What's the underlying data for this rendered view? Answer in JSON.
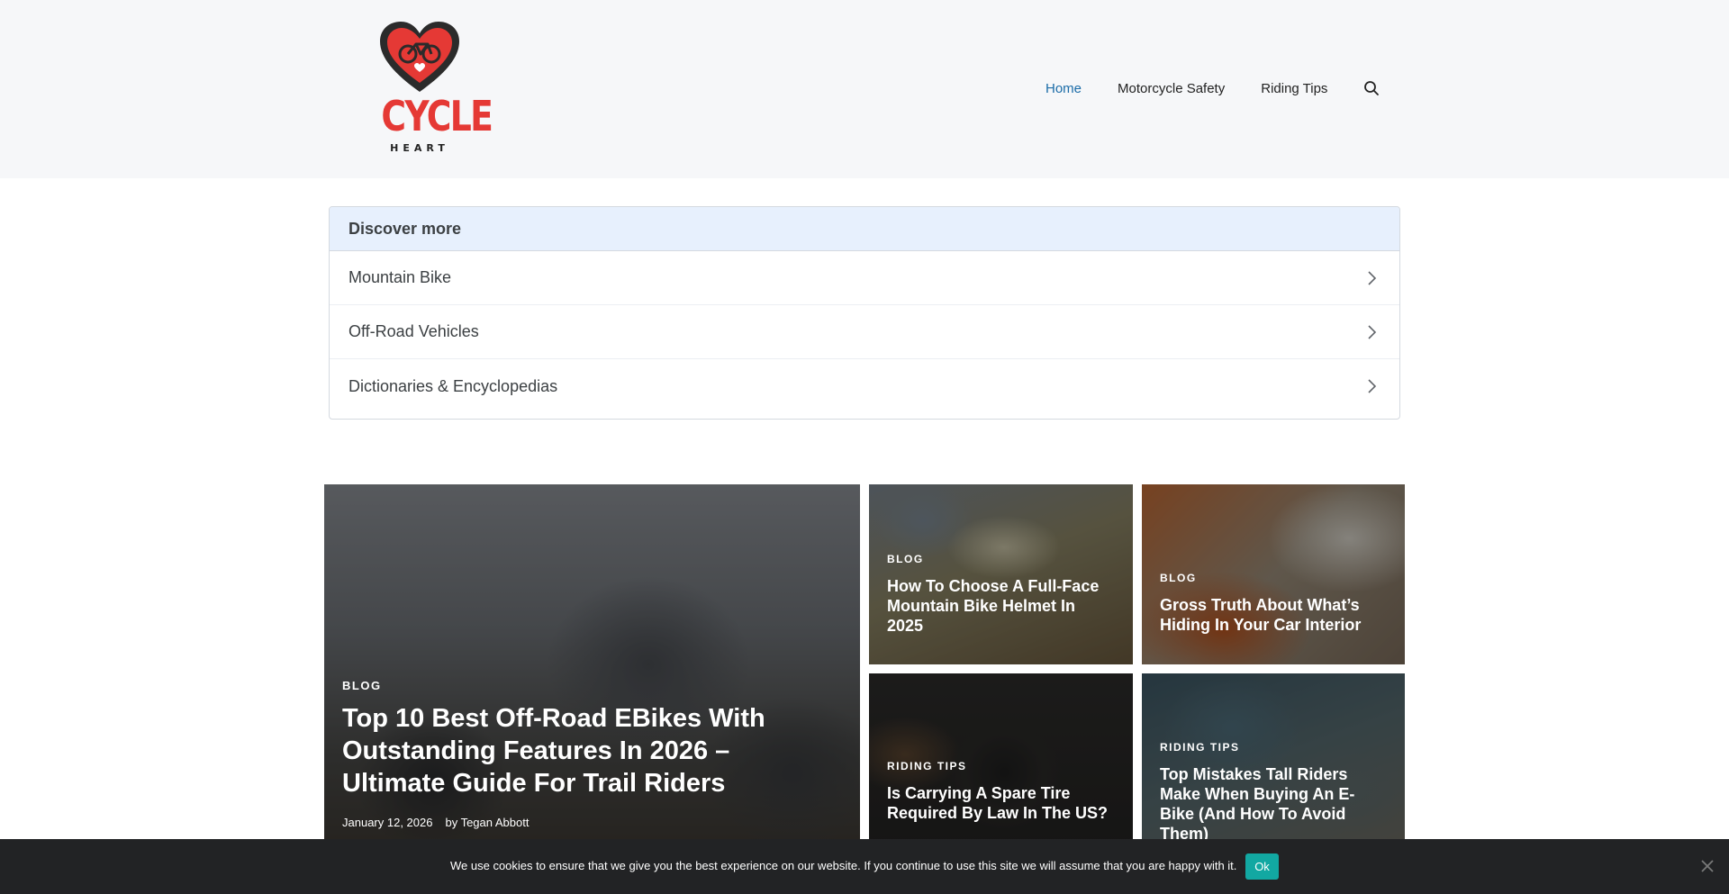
{
  "logo": {
    "word": "CYCLE",
    "sub": "HEART"
  },
  "nav": {
    "items": [
      {
        "label": "Home",
        "active": true
      },
      {
        "label": "Motorcycle Safety",
        "active": false
      },
      {
        "label": "Riding Tips",
        "active": false
      }
    ],
    "search_icon": "search-icon"
  },
  "discover": {
    "title": "Discover more",
    "items": [
      {
        "label": "Mountain Bike"
      },
      {
        "label": "Off-Road Vehicles"
      },
      {
        "label": "Dictionaries & Encyclopedias"
      }
    ]
  },
  "posts": {
    "main": {
      "category": "BLOG",
      "title": "Top 10 Best Off-Road EBikes With Outstanding Features In 2026 – Ultimate Guide For Trail Riders",
      "date": "January 12, 2026",
      "author": "by Tegan Abbott"
    },
    "a": {
      "category": "BLOG",
      "title": "How To Choose A Full-Face Mountain Bike Helmet In 2025"
    },
    "b": {
      "category": "BLOG",
      "title": "Gross Truth About What’s Hiding In Your Car Interior"
    },
    "c": {
      "category": "RIDING TIPS",
      "title": "Is Carrying A Spare Tire Required By Law In The US?"
    },
    "d": {
      "category": "RIDING TIPS",
      "title": "Top Mistakes Tall Riders Make When Buying An E-Bike (And How To Avoid Them)"
    }
  },
  "cookie": {
    "text": "We use cookies to ensure that we give you the best experience on our website. If you continue to use this site we will assume that you are happy with it.",
    "ok_label": "Ok"
  },
  "colors": {
    "accent": "#1b6ca8",
    "logo_red": "#e53935",
    "cookie_button": "#12a8a2",
    "discover_header": "#e7f0fd"
  }
}
